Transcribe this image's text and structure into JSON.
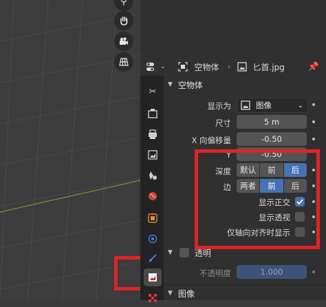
{
  "header": {
    "object_name": "空物体",
    "data_name": "匕首.jpg"
  },
  "panel": {
    "section_empty": "空物体",
    "display_as_label": "显示为",
    "display_as_value": "图像",
    "size_label": "尺寸",
    "size_value": "5 m",
    "offset_x_label": "X 向偏移量",
    "offset_x_value": "-0.50",
    "offset_y_label": "Y",
    "offset_y_value": "-0.50",
    "depth_label": "深度",
    "depth_options": [
      "默认",
      "前",
      "后"
    ],
    "depth_selected": "后",
    "side_label": "边",
    "side_options": [
      "两者",
      "前",
      "后"
    ],
    "side_selected": "前",
    "show_ortho_label": "显示正交",
    "show_ortho_checked": true,
    "show_persp_label": "显示透视",
    "show_persp_checked": false,
    "axis_aligned_label": "仅轴向对齐时显示",
    "axis_aligned_checked": false,
    "transparency_label": "透明",
    "opacity_label": "不透明度",
    "opacity_value": "1.000",
    "section_image": "图像"
  },
  "colors": {
    "accent": "#4772b3",
    "highlight_box": "#e02426"
  }
}
